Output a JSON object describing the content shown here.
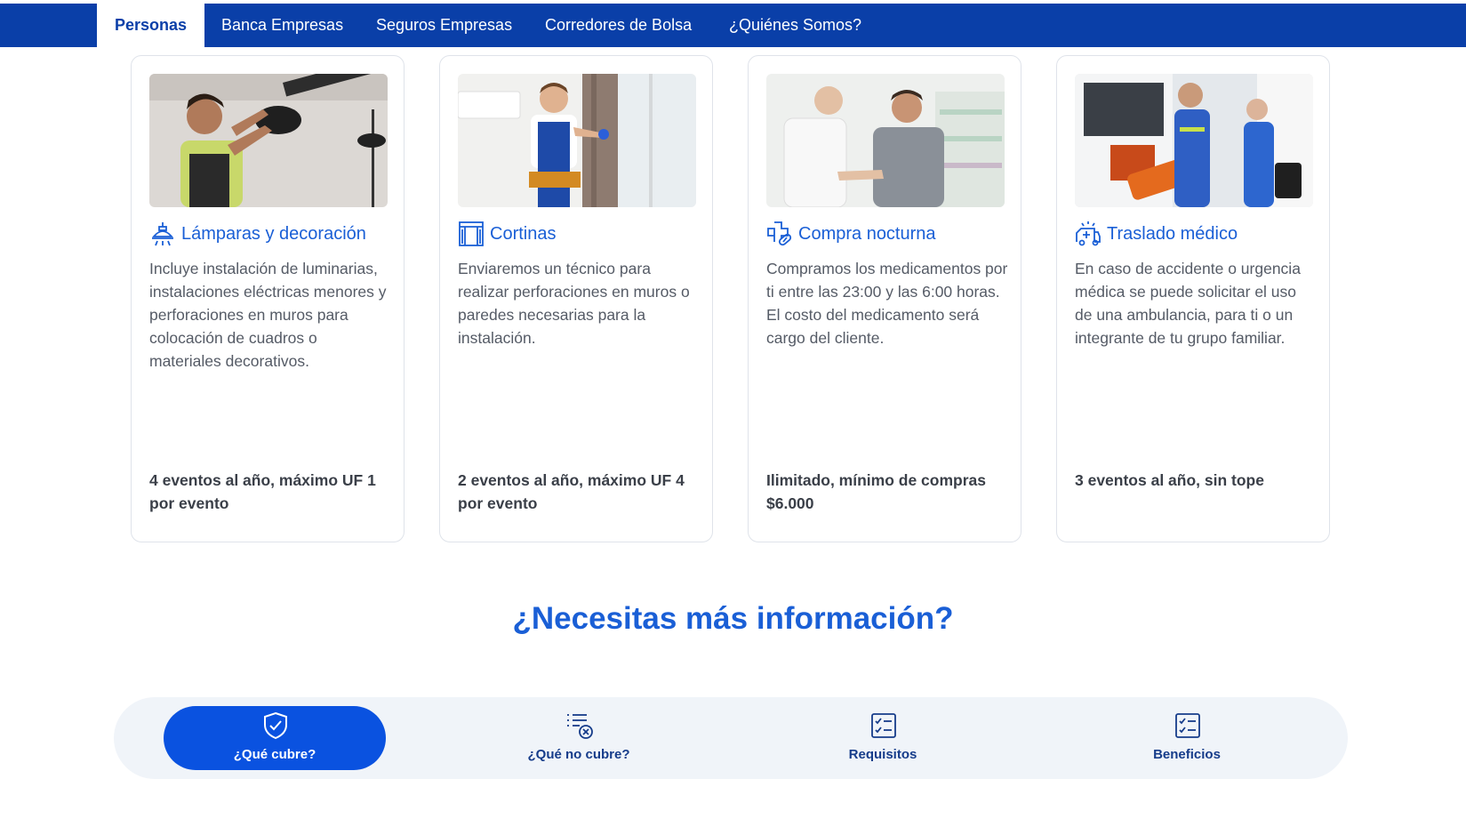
{
  "nav": {
    "tabs": [
      {
        "label": "Personas",
        "active": true
      },
      {
        "label": "Banca Empresas",
        "active": false
      },
      {
        "label": "Seguros Empresas",
        "active": false
      },
      {
        "label": "Corredores de Bolsa",
        "active": false
      },
      {
        "label": "¿Quiénes Somos?",
        "active": false
      }
    ]
  },
  "cards": [
    {
      "icon": "ceiling-lamp-icon",
      "title": "Lámparas y decoración",
      "description": "Incluye instalación de luminarias, instalaciones eléctricas menores y perforaciones en muros para colocación de cuadros o materiales decorativos.",
      "limit": "4 eventos al año, máximo UF 1 por evento"
    },
    {
      "icon": "curtain-window-icon",
      "title": "Cortinas",
      "description": "Enviaremos un técnico para realizar perforaciones en muros o paredes necesarias para la instalación.",
      "limit": "2 eventos al año, máximo UF 4 por evento"
    },
    {
      "icon": "medical-cross-pill-icon",
      "title": "Compra nocturna",
      "description": "Compramos los medicamentos por ti entre las 23:00 y las 6:00 horas. El costo del medicamento será cargo del cliente.",
      "limit": "Ilimitado, mínimo de compras $6.000"
    },
    {
      "icon": "ambulance-icon",
      "title": "Traslado médico",
      "description": "En caso de accidente o urgencia médica se puede solicitar el uso de una ambulancia, para ti o un integrante de tu grupo familiar.",
      "limit": "3 eventos al año, sin tope"
    }
  ],
  "info": {
    "title": "¿Necesitas más información?",
    "tabs": [
      {
        "label": "¿Qué cubre?",
        "icon": "shield-check-icon",
        "active": true
      },
      {
        "label": "¿Qué no cubre?",
        "icon": "list-x-icon",
        "active": false
      },
      {
        "label": "Requisitos",
        "icon": "checklist-icon",
        "active": false
      },
      {
        "label": "Beneficios",
        "icon": "checklist-icon",
        "active": false
      }
    ]
  },
  "colors": {
    "nav_bg": "#0a3fa8",
    "accent": "#1a5fd6",
    "active_pill": "#0a52e0"
  }
}
